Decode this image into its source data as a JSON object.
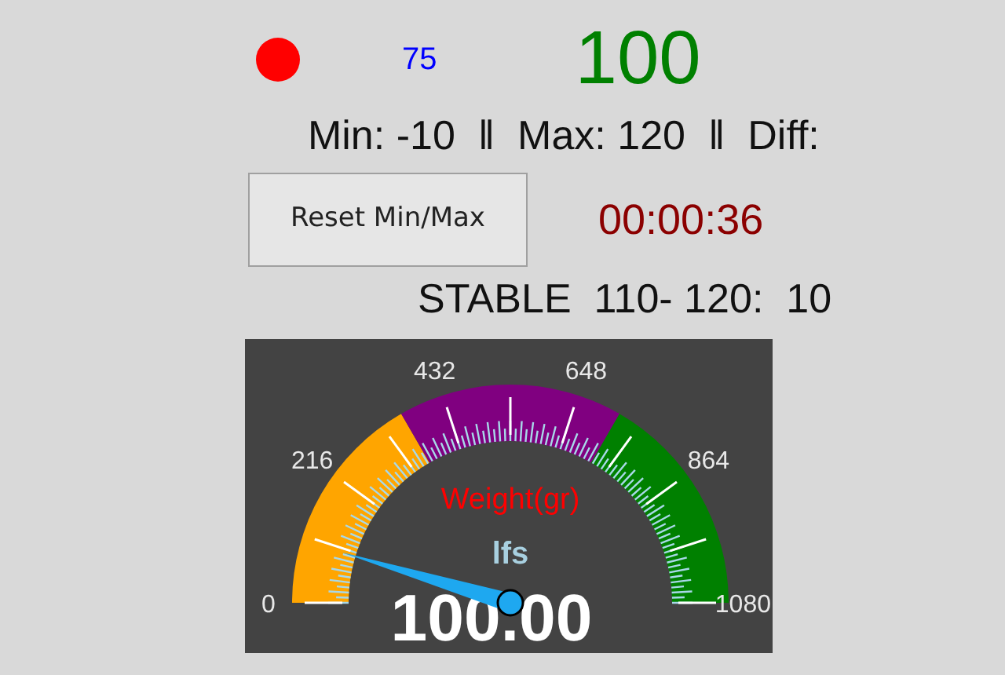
{
  "status_dot": {
    "color": "#ff0000"
  },
  "raw_reading": "75",
  "main_reading": "100",
  "stats": "Min: -10  ‖  Max: 120  ‖  Diff:",
  "reset_button": "Reset Min/Max",
  "timer": "00:00:36",
  "stable": "STABLE  110- 120:  10",
  "gauge": {
    "title": "Weight(gr)",
    "unit": "lfs",
    "value": "100.00",
    "zones": [
      {
        "color": "#ffa500"
      },
      {
        "color": "#800080"
      },
      {
        "color": "#008000"
      }
    ],
    "tick_labels": [
      "0",
      "216",
      "432",
      "648",
      "864",
      "1080"
    ]
  }
}
